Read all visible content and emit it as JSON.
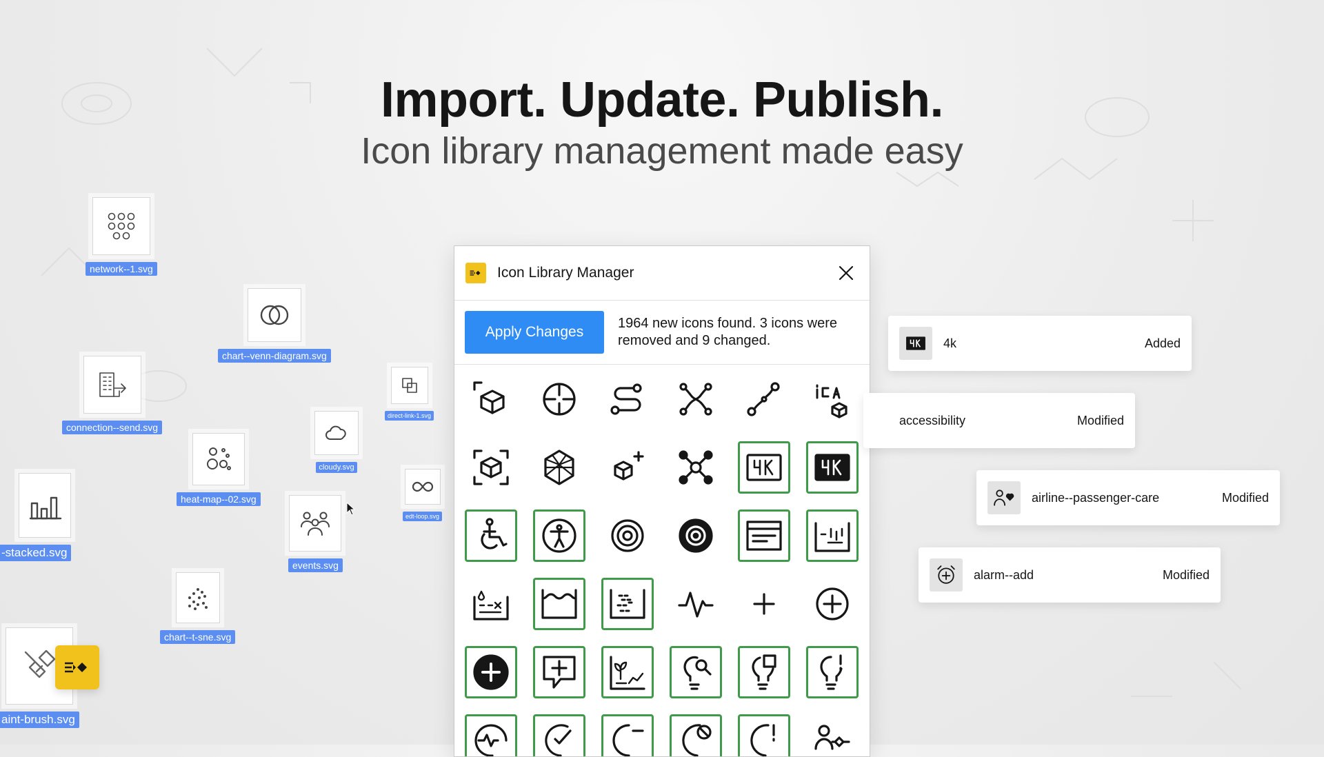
{
  "hero": {
    "title": "Import. Update. Publish.",
    "subtitle": "Icon library management made easy"
  },
  "files": [
    {
      "name": "network--1.svg",
      "icon": "network-icon"
    },
    {
      "name": "chart--venn-diagram.svg",
      "icon": "venn-diagram-icon"
    },
    {
      "name": "connection--send.svg",
      "icon": "connection-send-icon"
    },
    {
      "name": "direct-link-1.svg",
      "icon": "direct-link-icon"
    },
    {
      "name": "cloudy.svg",
      "icon": "cloudy-icon"
    },
    {
      "name": "heat-map--02.svg",
      "icon": "heat-map-icon"
    },
    {
      "name": "edt-loop.svg",
      "icon": "loop-icon"
    },
    {
      "name": "-stacked.svg",
      "icon": "bar-chart-icon"
    },
    {
      "name": "events.svg",
      "icon": "events-icon"
    },
    {
      "name": "chart--t-sne.svg",
      "icon": "scatter-icon"
    },
    {
      "name": "aint-brush.svg",
      "icon": "paint-brush-icon"
    }
  ],
  "dialog": {
    "title": "Icon Library Manager",
    "apply_label": "Apply Changes",
    "status": "1964 new icons found. 3 icons were removed and 9 changed.",
    "icons": [
      {
        "name": "3d-cursor-icon",
        "selected": false
      },
      {
        "name": "3d-cursor-alt-icon",
        "selected": false
      },
      {
        "name": "3d-curve-auto-colon-icon",
        "selected": false
      },
      {
        "name": "3d-curve-auto-vessels-icon",
        "selected": false
      },
      {
        "name": "3d-curve-manual-icon",
        "selected": false
      },
      {
        "name": "3d-ica-icon",
        "selected": false
      },
      {
        "name": "3d-mpr-toggle-icon",
        "selected": false
      },
      {
        "name": "3d-print-mesh-icon",
        "selected": false
      },
      {
        "name": "3d-software-icon",
        "selected": false
      },
      {
        "name": "3rd-party-connected-icon",
        "selected": false
      },
      {
        "name": "4k-icon",
        "selected": true
      },
      {
        "name": "4k-filled-icon",
        "selected": true
      },
      {
        "name": "accessibility-icon",
        "selected": true
      },
      {
        "name": "accessibility-alt-icon",
        "selected": true
      },
      {
        "name": "accessibility-color-icon",
        "selected": false
      },
      {
        "name": "accessibility-color-filled-icon",
        "selected": false
      },
      {
        "name": "account-icon",
        "selected": true
      },
      {
        "name": "accumulation-ice-icon",
        "selected": true
      },
      {
        "name": "accumulation-precipitation-icon",
        "selected": false
      },
      {
        "name": "accumulation-rain-icon",
        "selected": true
      },
      {
        "name": "accumulation-snow-icon",
        "selected": true
      },
      {
        "name": "activity-icon",
        "selected": false
      },
      {
        "name": "add-icon",
        "selected": false
      },
      {
        "name": "add-alt-icon",
        "selected": false
      },
      {
        "name": "add-filled-icon",
        "selected": false
      },
      {
        "name": "add-comment-icon",
        "selected": true
      },
      {
        "name": "agriculture-analytics-icon",
        "selected": true
      },
      {
        "name": "ai-results-icon",
        "selected": true
      },
      {
        "name": "ai-results-high-icon",
        "selected": true
      },
      {
        "name": "ai-results-urgent-icon",
        "selected": true
      },
      {
        "name": "ai-status-icon",
        "selected": true
      },
      {
        "name": "ai-status-complete-icon",
        "selected": true
      },
      {
        "name": "ai-status-failed-icon",
        "selected": true
      },
      {
        "name": "ai-status-in-progress-icon",
        "selected": true
      },
      {
        "name": "ai-status-queued-icon",
        "selected": true
      },
      {
        "name": "airline-passenger-care-icon",
        "selected": false
      }
    ]
  },
  "changes": [
    {
      "name": "4k",
      "status": "Added",
      "icon": "4k-filled-icon"
    },
    {
      "name": "accessibility",
      "status": "Modified",
      "icon": "accessibility-icon"
    },
    {
      "name": "airline--passenger-care",
      "status": "Modified",
      "icon": "airline-passenger-care-icon"
    },
    {
      "name": "alarm--add",
      "status": "Modified",
      "icon": "alarm-add-icon"
    }
  ],
  "colors": {
    "accent": "#2f8cf4",
    "selection": "#3f9b4a",
    "brand": "#f1c21b",
    "file_label": "#5b8ef0"
  }
}
